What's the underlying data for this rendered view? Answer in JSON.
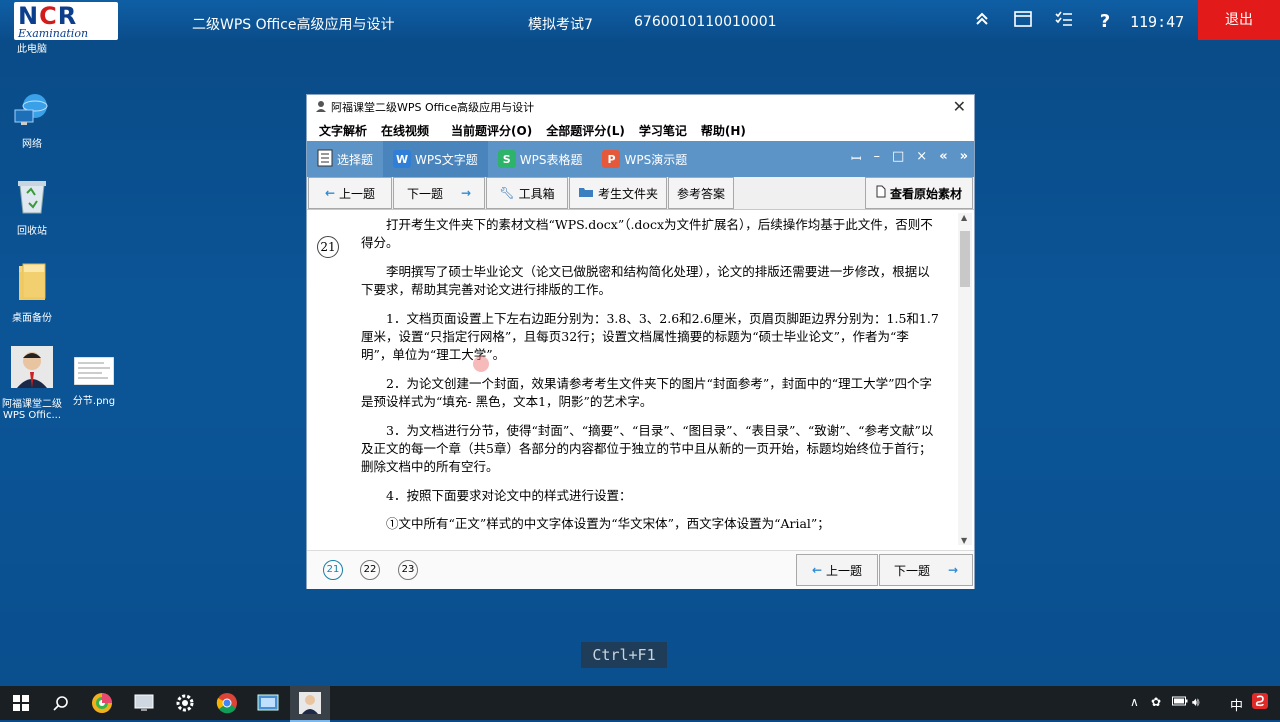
{
  "topbar": {
    "logo_text": "NCR",
    "logo_sub": "Examination",
    "exam_title": "二级WPS Office高级应用与设计",
    "exam_name": "模拟考试7",
    "exam_id": "6760010110010001",
    "timer": "119:47",
    "exit_label": "退出"
  },
  "desktop": {
    "icons": [
      {
        "label": "此电脑"
      },
      {
        "label": "网络"
      },
      {
        "label": "回收站"
      },
      {
        "label": "桌面备份"
      },
      {
        "label": "阿福课堂二级WPS Offic..."
      },
      {
        "label": "分节.png"
      }
    ]
  },
  "window": {
    "title": "阿福课堂二级WPS Office高级应用与设计",
    "menu": [
      "文字解析",
      "在线视频",
      "当前题评分(O)",
      "全部题评分(L)",
      "学习笔记",
      "帮助(H)"
    ],
    "tabs": [
      {
        "label": "选择题",
        "icon_char": ""
      },
      {
        "label": "WPS文字题",
        "icon_char": "W"
      },
      {
        "label": "WPS表格题",
        "icon_char": "S"
      },
      {
        "label": "WPS演示题",
        "icon_char": "P"
      }
    ],
    "tab_controls": [
      "ꟷ",
      "–",
      "□",
      "×",
      "«",
      "»"
    ],
    "toolbar": {
      "prev": "上一题",
      "next": "下一题",
      "tools": "工具箱",
      "folder": "考生文件夹",
      "answer": "参考答案",
      "original": "查看原始素材"
    },
    "question_number": "21",
    "paragraphs": [
      "打开考生文件夹下的素材文档“WPS.docx”（.docx为文件扩展名），后续操作均基于此文件，否则不得分。",
      "李明撰写了硕士毕业论文（论文已做脱密和结构简化处理），论文的排版还需要进一步修改，根据以下要求，帮助其完善对论文进行排版的工作。",
      "1．文档页面设置上下左右边距分别为：3.8、3、2.6和2.6厘米，页眉页脚距边界分别为：1.5和1.7厘米，设置“只指定行网格”，且每页32行；设置文档属性摘要的标题为“硕士毕业论文”，作者为“李明”，单位为“理工大学”。",
      "2．为论文创建一个封面，效果请参考考生文件夹下的图片“封面参考”，封面中的“理工大学”四个字是预设样式为“填充- 黑色，文本1，阴影”的艺术字。",
      "3．为文档进行分节，使得“封面”、“摘要”、“目录”、“图目录”、“表目录”、“致谢”、“参考文献”以及正文的每一个章（共5章）各部分的内容都位于独立的节中且从新的一页开始，标题均始终位于首行；删除文档中的所有空行。",
      "4．按照下面要求对论文中的样式进行设置：",
      "①文中所有“正文”样式的中文字体设置为“华文宋体”，西文字体设置为“Arial”；"
    ],
    "footer": {
      "questions": [
        "21",
        "22",
        "23"
      ],
      "prev": "上一题",
      "next": "下一题"
    }
  },
  "shortcut_hint": "Ctrl+F1",
  "taskbar": {
    "ime": "中"
  }
}
